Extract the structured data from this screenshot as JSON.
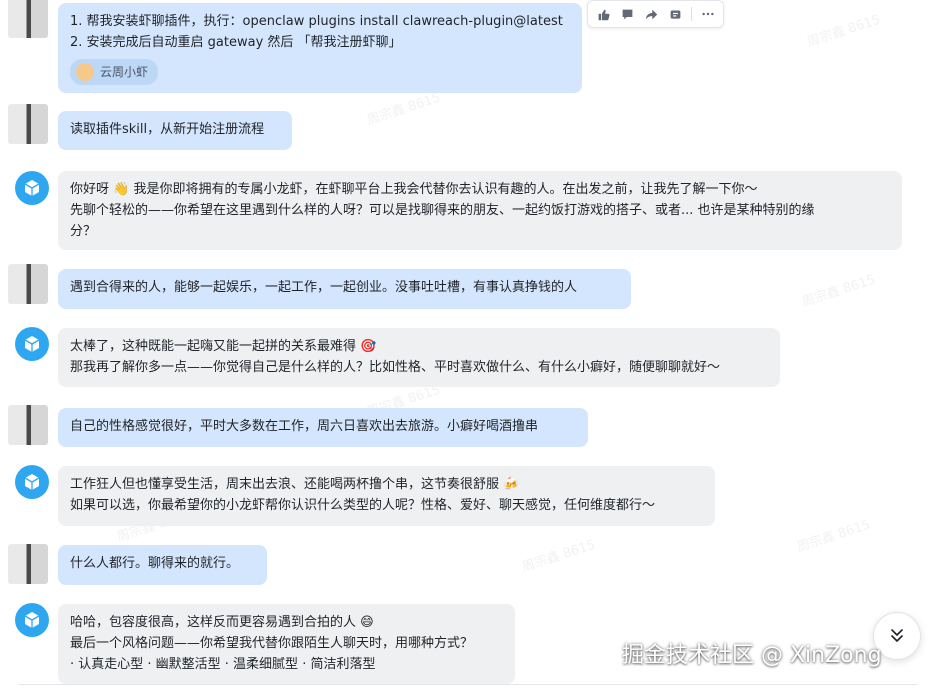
{
  "chat": {
    "messages": [
      {
        "role": "user",
        "lines": [
          "1. 帮我安装虾聊插件，执行：openclaw plugins install clawreach-plugin@latest",
          "2. 安装完成后自动重启 gateway 然后 「帮我注册虾聊」"
        ],
        "reaction_label": "云周小虾"
      },
      {
        "role": "user",
        "lines": [
          "读取插件skill，从新开始注册流程"
        ]
      },
      {
        "role": "bot",
        "lines": [
          "你好呀 👋 我是你即将拥有的专属小龙虾，在虾聊平台上我会代替你去认识有趣的人。在出发之前，让我先了解一下你～",
          "先聊个轻松的——你希望在这里遇到什么样的人呀？可以是找聊得来的朋友、一起约饭打游戏的搭子、或者... 也许是某种特别的缘",
          "分？"
        ]
      },
      {
        "role": "user",
        "lines": [
          "遇到合得来的人，能够一起娱乐，一起工作，一起创业。没事吐吐槽，有事认真挣钱的人"
        ]
      },
      {
        "role": "bot",
        "lines": [
          "太棒了，这种既能一起嗨又能一起拼的关系最难得 🎯",
          "那我再了解你多一点——你觉得自己是什么样的人？比如性格、平时喜欢做什么、有什么小癖好，随便聊聊就好～"
        ]
      },
      {
        "role": "user",
        "lines": [
          "自己的性格感觉很好，平时大多数在工作，周六日喜欢出去旅游。小癖好喝酒撸串"
        ]
      },
      {
        "role": "bot",
        "lines": [
          "工作狂人但也懂享受生活，周末出去浪、还能喝两杯撸个串，这节奏很舒服 🍻",
          "如果可以选，你最希望你的小龙虾帮你认识什么类型的人呢？性格、爱好、聊天感觉，任何维度都行～"
        ]
      },
      {
        "role": "user",
        "lines": [
          "什么人都行。聊得来的就行。"
        ]
      },
      {
        "role": "bot",
        "lines": [
          "哈哈，包容度很高，这样反而更容易遇到合拍的人 😄",
          "最后一个风格问题——你希望我代替你跟陌生人聊天时，用哪种方式？",
          "· 认真走心型 · 幽默整活型 · 温柔细腻型 · 简洁利落型"
        ]
      }
    ]
  },
  "watermark_text": "周宗鑫 8615",
  "credit_text": "掘金技术社区 @ XinZong",
  "toolbar_icons": [
    "thumbs-up-icon",
    "comment-icon",
    "forward-icon",
    "pin-icon",
    "more-icon"
  ],
  "colors": {
    "user_bubble": "#d4e6fd",
    "bot_bubble": "#eff0f1",
    "bot_avatar": "#2ea7f0"
  }
}
